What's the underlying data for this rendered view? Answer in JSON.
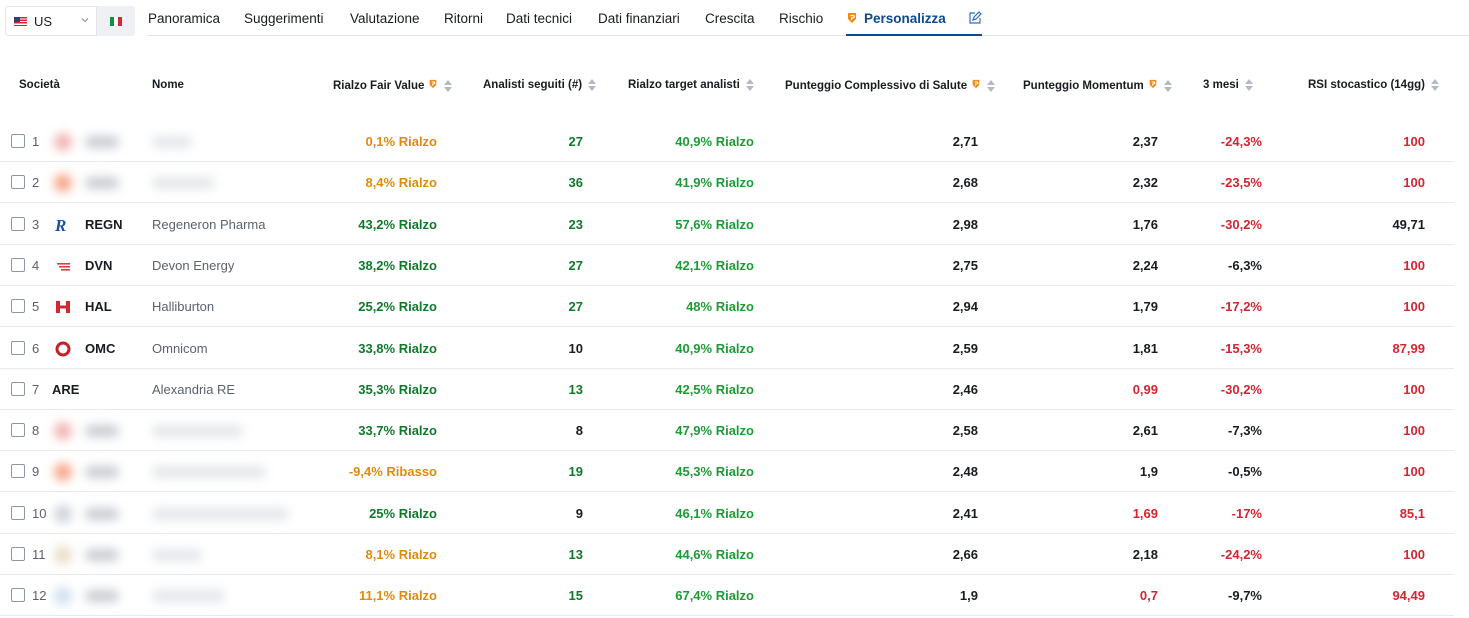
{
  "market": {
    "selected": "US",
    "alt_flag_icon": "flag-italy-icon"
  },
  "tabs": [
    {
      "label": "Panoramica",
      "active": false
    },
    {
      "label": "Suggerimenti",
      "active": false
    },
    {
      "label": "Valutazione",
      "active": false
    },
    {
      "label": "Ritorni",
      "active": false
    },
    {
      "label": "Dati tecnici",
      "active": false
    },
    {
      "label": "Dati finanziari",
      "active": false
    },
    {
      "label": "Crescita",
      "active": false
    },
    {
      "label": "Rischio",
      "active": false
    },
    {
      "label": "Personalizza",
      "active": true
    }
  ],
  "colors": {
    "accent": "#0b4a8f",
    "pro": "#f18a12",
    "positive": "#0f7b2a",
    "negative": "#d22630",
    "warning": "#e08b0c"
  },
  "table": {
    "headers": {
      "company": "Società",
      "name": "Nome",
      "fair_value": "Rialzo Fair Value",
      "analysts": "Analisti seguiti (#)",
      "target": "Rialzo target analisti",
      "health": "Punteggio Complessivo di Salute",
      "momentum": "Punteggio Momentum",
      "three_months": "3 mesi",
      "rsi": "RSI stocastico (14gg)"
    },
    "rows": [
      {
        "rank": "1",
        "ticker": "",
        "name": "",
        "blurred": true,
        "fair_value": "0,1% Rialzo",
        "fv_tone": "orange",
        "analysts": "27",
        "an_tone": "green",
        "target": "40,9% Rialzo",
        "health": "2,71",
        "momentum": "2,37",
        "mo_tone": "black",
        "three_months": "-24,3%",
        "tm_tone": "red",
        "rsi": "100",
        "rsi_tone": "red"
      },
      {
        "rank": "2",
        "ticker": "",
        "name": "",
        "blurred": true,
        "fair_value": "8,4% Rialzo",
        "fv_tone": "orange",
        "analysts": "36",
        "an_tone": "green",
        "target": "41,9% Rialzo",
        "health": "2,68",
        "momentum": "2,32",
        "mo_tone": "black",
        "three_months": "-23,5%",
        "tm_tone": "red",
        "rsi": "100",
        "rsi_tone": "red"
      },
      {
        "rank": "3",
        "ticker": "REGN",
        "name": "Regeneron Pharma",
        "blurred": false,
        "logo": "regn",
        "fair_value": "43,2% Rialzo",
        "fv_tone": "green",
        "analysts": "23",
        "an_tone": "green",
        "target": "57,6% Rialzo",
        "health": "2,98",
        "momentum": "1,76",
        "mo_tone": "black",
        "three_months": "-30,2%",
        "tm_tone": "red",
        "rsi": "49,71",
        "rsi_tone": "black"
      },
      {
        "rank": "4",
        "ticker": "DVN",
        "name": "Devon Energy",
        "blurred": false,
        "logo": "dvn",
        "fair_value": "38,2% Rialzo",
        "fv_tone": "green",
        "analysts": "27",
        "an_tone": "green",
        "target": "42,1% Rialzo",
        "health": "2,75",
        "momentum": "2,24",
        "mo_tone": "black",
        "three_months": "-6,3%",
        "tm_tone": "black",
        "rsi": "100",
        "rsi_tone": "red"
      },
      {
        "rank": "5",
        "ticker": "HAL",
        "name": "Halliburton",
        "blurred": false,
        "logo": "hal",
        "fair_value": "25,2% Rialzo",
        "fv_tone": "green",
        "analysts": "27",
        "an_tone": "green",
        "target": "48% Rialzo",
        "health": "2,94",
        "momentum": "1,79",
        "mo_tone": "black",
        "three_months": "-17,2%",
        "tm_tone": "red",
        "rsi": "100",
        "rsi_tone": "red"
      },
      {
        "rank": "6",
        "ticker": "OMC",
        "name": "Omnicom",
        "blurred": false,
        "logo": "omc",
        "fair_value": "33,8% Rialzo",
        "fv_tone": "green",
        "analysts": "10",
        "an_tone": "black",
        "target": "40,9% Rialzo",
        "health": "2,59",
        "momentum": "1,81",
        "mo_tone": "black",
        "three_months": "-15,3%",
        "tm_tone": "red",
        "rsi": "87,99",
        "rsi_tone": "red"
      },
      {
        "rank": "7",
        "ticker": "ARE",
        "name": "Alexandria RE",
        "blurred": false,
        "logo": "",
        "fair_value": "35,3% Rialzo",
        "fv_tone": "green",
        "analysts": "13",
        "an_tone": "green",
        "target": "42,5% Rialzo",
        "health": "2,46",
        "momentum": "0,99",
        "mo_tone": "red",
        "three_months": "-30,2%",
        "tm_tone": "red",
        "rsi": "100",
        "rsi_tone": "red"
      },
      {
        "rank": "8",
        "ticker": "",
        "name": "",
        "blurred": true,
        "fair_value": "33,7% Rialzo",
        "fv_tone": "green",
        "analysts": "8",
        "an_tone": "black",
        "target": "47,9% Rialzo",
        "health": "2,58",
        "momentum": "2,61",
        "mo_tone": "black",
        "three_months": "-7,3%",
        "tm_tone": "black",
        "rsi": "100",
        "rsi_tone": "red"
      },
      {
        "rank": "9",
        "ticker": "",
        "name": "",
        "blurred": true,
        "fair_value": "-9,4% Ribasso",
        "fv_tone": "orange",
        "analysts": "19",
        "an_tone": "green",
        "target": "45,3% Rialzo",
        "health": "2,48",
        "momentum": "1,9",
        "mo_tone": "black",
        "three_months": "-0,5%",
        "tm_tone": "black",
        "rsi": "100",
        "rsi_tone": "red"
      },
      {
        "rank": "10",
        "ticker": "",
        "name": "",
        "blurred": true,
        "fair_value": "25% Rialzo",
        "fv_tone": "green",
        "analysts": "9",
        "an_tone": "black",
        "target": "46,1% Rialzo",
        "health": "2,41",
        "momentum": "1,69",
        "mo_tone": "red",
        "three_months": "-17%",
        "tm_tone": "red",
        "rsi": "85,1",
        "rsi_tone": "red"
      },
      {
        "rank": "11",
        "ticker": "",
        "name": "",
        "blurred": true,
        "fair_value": "8,1% Rialzo",
        "fv_tone": "orange",
        "analysts": "13",
        "an_tone": "green",
        "target": "44,6% Rialzo",
        "health": "2,66",
        "momentum": "2,18",
        "mo_tone": "black",
        "three_months": "-24,2%",
        "tm_tone": "red",
        "rsi": "100",
        "rsi_tone": "red"
      },
      {
        "rank": "12",
        "ticker": "",
        "name": "",
        "blurred": true,
        "fair_value": "11,1% Rialzo",
        "fv_tone": "orange",
        "analysts": "15",
        "an_tone": "green",
        "target": "67,4% Rialzo",
        "health": "1,9",
        "momentum": "0,7",
        "mo_tone": "red",
        "three_months": "-9,7%",
        "tm_tone": "black",
        "rsi": "94,49",
        "rsi_tone": "red"
      }
    ]
  }
}
